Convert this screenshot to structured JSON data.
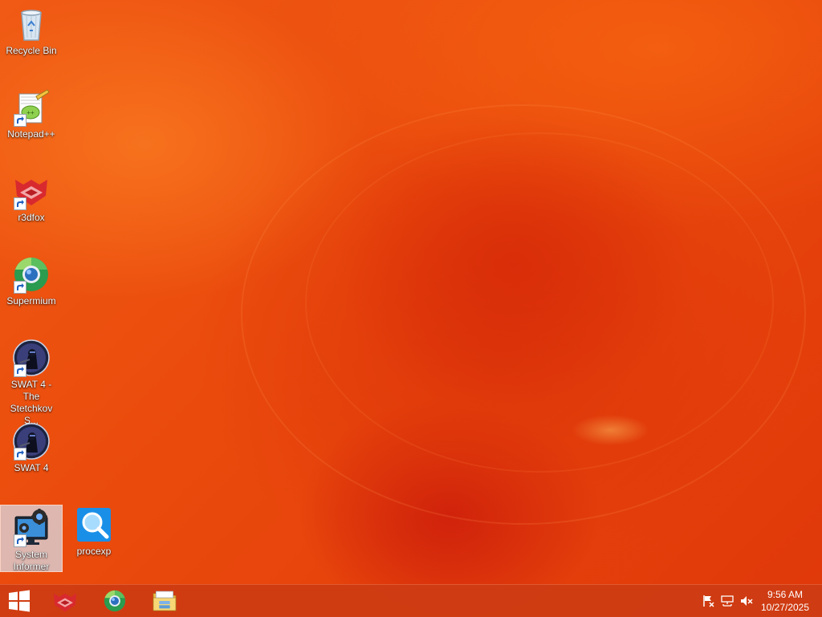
{
  "desktop": {
    "icons": [
      {
        "id": "recycle-bin",
        "label": "Recycle Bin",
        "icon": "recycle-bin-icon",
        "shortcut": false
      },
      {
        "id": "notepad-plus-plus",
        "label": "Notepad++",
        "icon": "notepad-plus-plus-icon",
        "shortcut": true
      },
      {
        "id": "r3dfox",
        "label": "r3dfox",
        "icon": "r3dfox-icon",
        "shortcut": true
      },
      {
        "id": "supermium",
        "label": "Supermium",
        "icon": "supermium-icon",
        "shortcut": true
      },
      {
        "id": "swat4-stetchkov",
        "label": "SWAT 4 - The Stetchkov S...",
        "icon": "swat4-icon",
        "shortcut": true
      },
      {
        "id": "swat4",
        "label": "SWAT 4",
        "icon": "swat4-icon",
        "shortcut": true
      },
      {
        "id": "system-informer",
        "label": "System Informer",
        "icon": "system-informer-icon",
        "shortcut": true,
        "selected": true
      },
      {
        "id": "procexp",
        "label": "procexp",
        "icon": "procexp-icon",
        "shortcut": false
      }
    ]
  },
  "taskbar": {
    "start": {
      "icon": "windows-logo-icon"
    },
    "pinned": [
      {
        "id": "r3dfox",
        "icon": "r3dfox-icon"
      },
      {
        "id": "supermium",
        "icon": "supermium-icon"
      },
      {
        "id": "file-explorer",
        "icon": "file-explorer-icon"
      }
    ],
    "tray": [
      {
        "id": "action-center",
        "icon": "action-center-flag-icon"
      },
      {
        "id": "network",
        "icon": "network-icon"
      },
      {
        "id": "volume",
        "icon": "volume-muted-icon"
      }
    ],
    "clock": {
      "time": "9:56 AM",
      "date": "10/27/2025"
    }
  },
  "colors": {
    "wallpaper_primary": "#e94a0b",
    "taskbar": "#cd3c14",
    "selection": "#d7e1f0"
  }
}
